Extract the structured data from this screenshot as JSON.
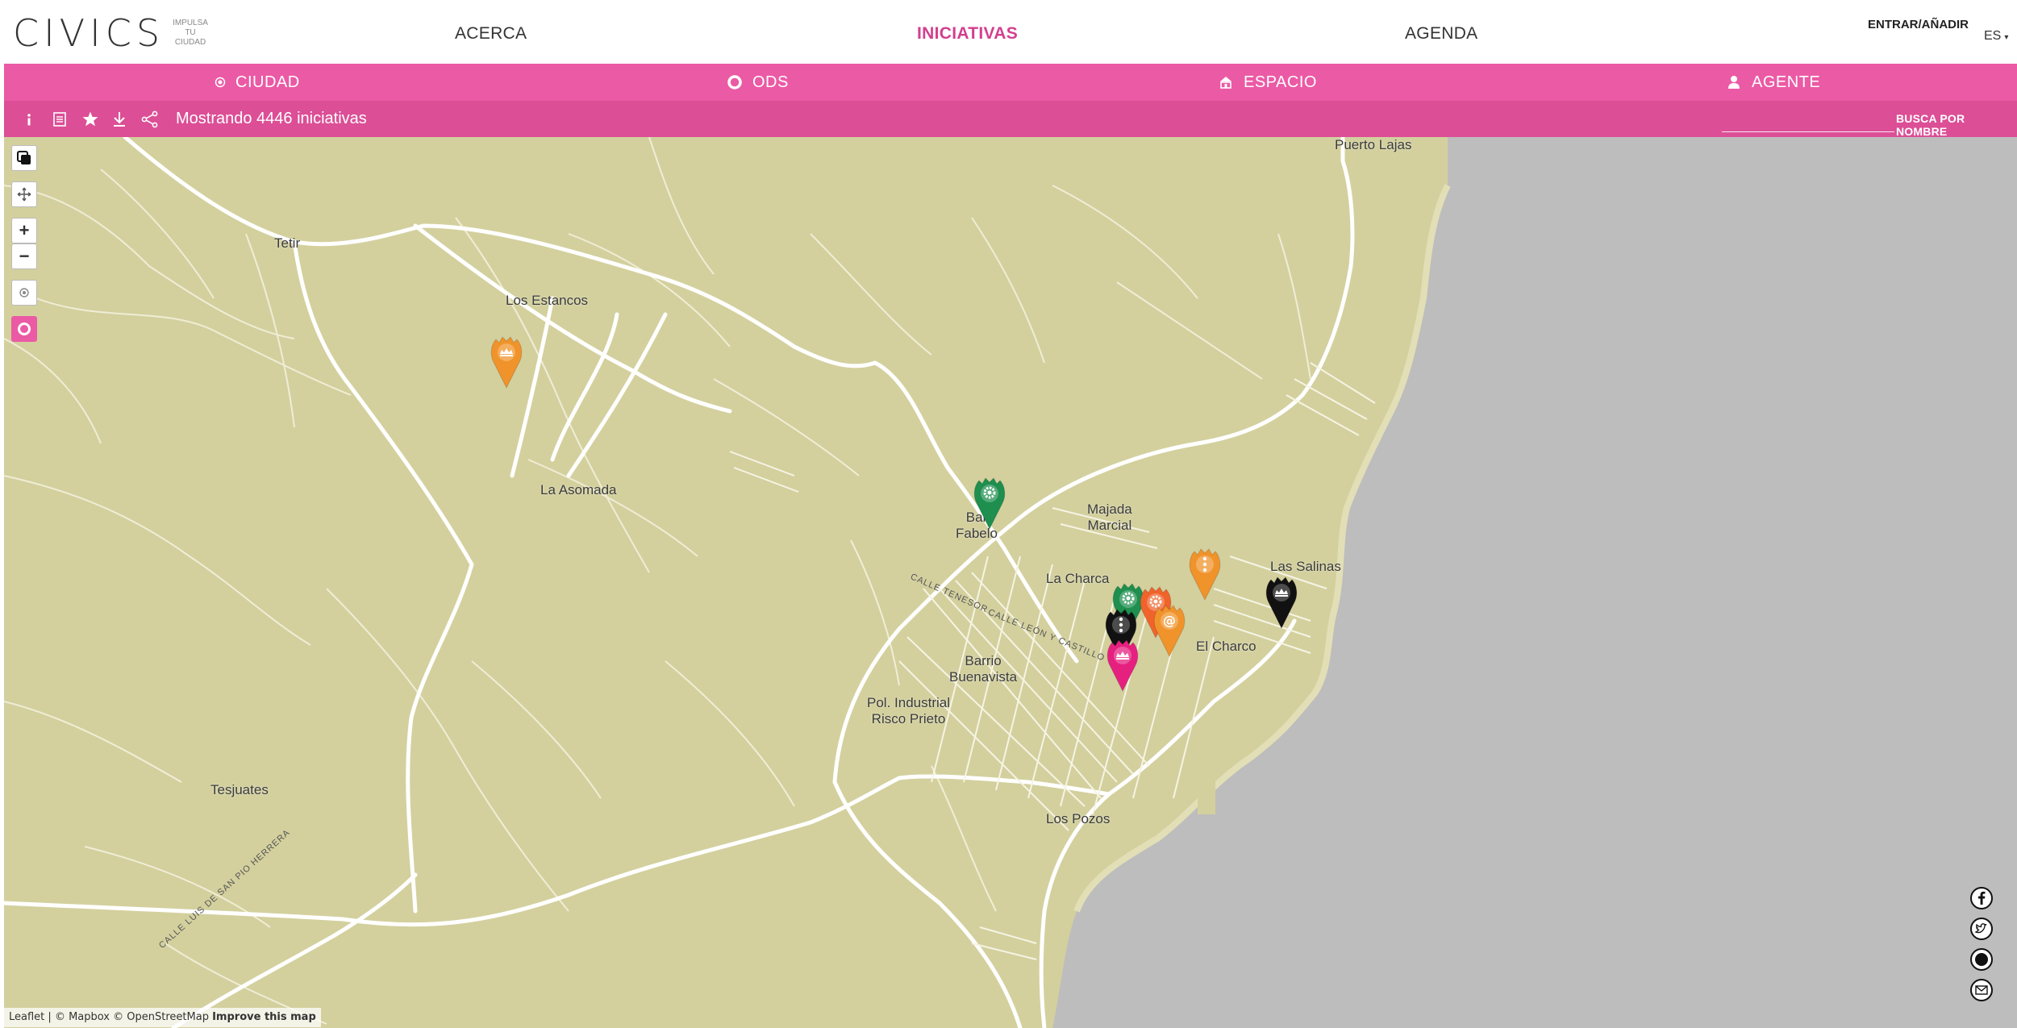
{
  "header": {
    "logo_word": "CIVICS",
    "logo_tagline": [
      "IMPULSA",
      "TU",
      "CIUDAD"
    ],
    "nav": [
      {
        "label": "ACERCA",
        "active": false
      },
      {
        "label": "INICIATIVAS",
        "active": true
      },
      {
        "label": "AGENDA",
        "active": false
      }
    ],
    "login_label": "ENTRAR/AÑADIR",
    "language": "ES"
  },
  "filters": [
    {
      "label": "CIUDAD",
      "icon": "dot-circle-icon"
    },
    {
      "label": "ODS",
      "icon": "ring-icon"
    },
    {
      "label": "ESPACIO",
      "icon": "building-icon"
    },
    {
      "label": "AGENTE",
      "icon": "person-icon"
    }
  ],
  "toolbar": {
    "tools": [
      "info-icon",
      "list-icon",
      "star-icon",
      "download-icon",
      "share-icon"
    ],
    "count_text": "Mostrando 4446 iniciativas",
    "search_label": "BUSCA POR NOMBRE",
    "search_placeholder": ""
  },
  "map": {
    "places": [
      {
        "name": "Puerto Lajas"
      },
      {
        "name": "Tetir"
      },
      {
        "name": "Los Estancos"
      },
      {
        "name": "La Asomada"
      },
      {
        "name": "Bar\nFabelo"
      },
      {
        "name": "Majada\nMarcial"
      },
      {
        "name": "La Charca"
      },
      {
        "name": "Las Salinas"
      },
      {
        "name": "El Charco"
      },
      {
        "name": "Barrio\nBuenavista"
      },
      {
        "name": "Pol. Industrial\nRisco Prieto"
      },
      {
        "name": "Tesjuates"
      },
      {
        "name": "Los Pozos"
      }
    ],
    "streets": [
      "CALLE TENESOR",
      "CALLE LEÓN Y CASTILLO",
      "CALLE LUIS DE SAN PIO HERRERA"
    ],
    "markers": [
      {
        "color": "#f0932b",
        "symbol": "crown"
      },
      {
        "color": "#1e8f4e",
        "symbol": "gear"
      },
      {
        "color": "#f0932b",
        "symbol": "dots"
      },
      {
        "color": "#111111",
        "symbol": "crown"
      },
      {
        "color": "#1e8f4e",
        "symbol": "gear"
      },
      {
        "color": "#f0632b",
        "symbol": "gear"
      },
      {
        "color": "#f0932b",
        "symbol": "at"
      },
      {
        "color": "#111111",
        "symbol": "dots"
      },
      {
        "color": "#e6207f",
        "symbol": "crown"
      }
    ],
    "controls": [
      "layers-icon",
      "move-icon",
      "zoom-in-icon",
      "zoom-out-icon",
      "locate-icon",
      "ring-toggle-icon"
    ],
    "attribution": {
      "leaflet": "Leaflet",
      "sep": "|",
      "mapbox": "© Mapbox",
      "osm": "© OpenStreetMap",
      "improve": "Improve this map"
    }
  },
  "social": [
    "facebook-icon",
    "twitter-icon",
    "instagram-icon",
    "email-icon"
  ],
  "colors": {
    "accent": "#eb5aa5",
    "accent_dark": "#dc4e96",
    "land": "#d3d09e",
    "sea": "#bdbdbd",
    "road": "#ffffff"
  }
}
